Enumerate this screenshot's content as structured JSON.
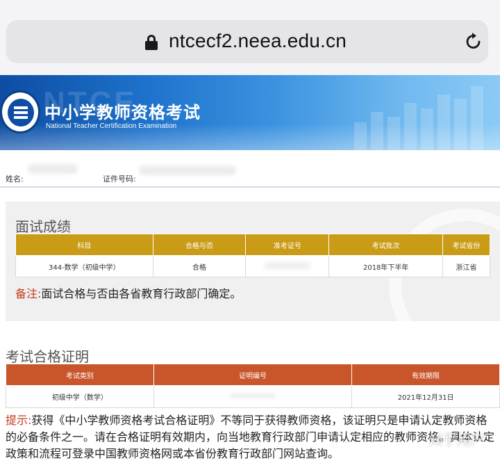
{
  "browser": {
    "url": "ntcecf2.neea.edu.cn"
  },
  "banner": {
    "title_cn": "中小学教师资格考试",
    "title_en": "National Teacher Certification Examination",
    "ghost_text": "NTCE"
  },
  "info": {
    "name_label": "姓名:",
    "id_label": "证件号码:"
  },
  "interview": {
    "title": "面试成绩",
    "headers": [
      "科目",
      "合格与否",
      "准考证号",
      "考试批次",
      "考试省份"
    ],
    "row": {
      "subject": "344-数学（初级中学）",
      "result": "合格",
      "ticket": "",
      "batch": "2018年下半年",
      "province": "浙江省"
    },
    "note_label": "备注:",
    "note_text": "面试合格与否由各省教育行政部门确定。"
  },
  "certificate": {
    "title": "考试合格证明",
    "headers": [
      "考试类别",
      "证明编号",
      "有效期限"
    ],
    "row": {
      "category": "初级中学（数学）",
      "number": "",
      "expiry": "2021年12月31日"
    },
    "tip_label": "提示:",
    "tip_text": "获得《中小学教师资格考试合格证明》不等同于获得教师资格，该证明只是申请认定教师资格的必备条件之一。请在合格证明有效期内，向当地教育行政部门申请认定相应的教师资格。具体认定政策和流程可登录中国教师资格网或本省份教育行政部门网站查询。"
  },
  "watermark": "知乎用户",
  "colors": {
    "interview_header": "#c99b16",
    "certificate_header": "#c9552b",
    "note_label": "#c23a1f",
    "banner_blue": "#1e73cc"
  }
}
